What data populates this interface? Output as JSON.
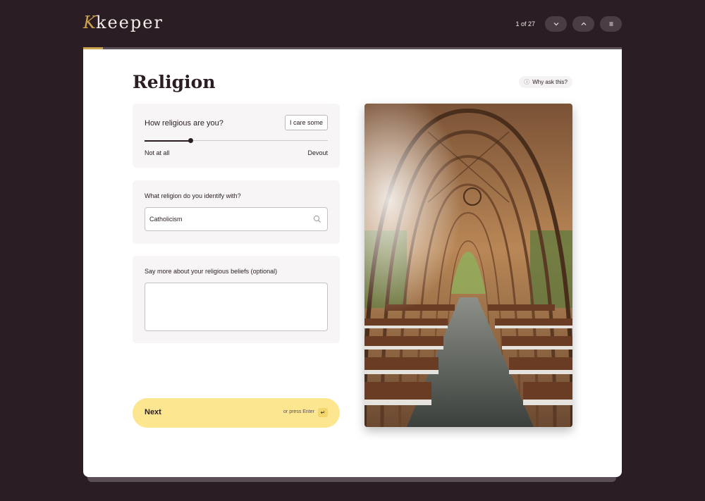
{
  "app": {
    "logo_text": "keeper"
  },
  "header": {
    "pager": "1 of 27",
    "progress_fraction": 0.037
  },
  "page": {
    "title": "Religion",
    "why_label": "Why ask this?"
  },
  "religiosity": {
    "question": "How religious are you?",
    "value_badge": "I care some",
    "slider_value": 0.25,
    "min_label": "Not at all",
    "max_label": "Devout"
  },
  "religion": {
    "question": "What religion do you identify with?",
    "value": "Catholicism"
  },
  "beliefs": {
    "question": "Say more about your religious beliefs (optional)",
    "value": ""
  },
  "next": {
    "label": "Next",
    "hint": "or press Enter",
    "key_glyph": "↵"
  },
  "icons": {
    "down": "chevron-down-icon",
    "up": "chevron-up-icon",
    "menu": "menu-icon",
    "info": "info-icon",
    "search": "search-icon"
  },
  "colors": {
    "background": "#2a1d24",
    "accent_gold": "#c9a44c",
    "next_button": "#fce690"
  }
}
